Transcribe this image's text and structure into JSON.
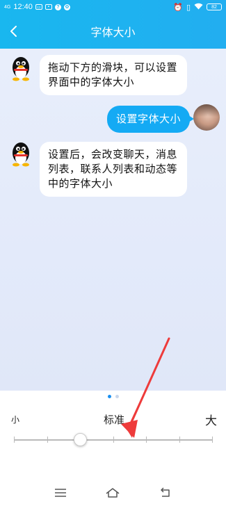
{
  "status_bar": {
    "network": "4G",
    "time": "12:40",
    "battery": "82"
  },
  "nav": {
    "title": "字体大小"
  },
  "messages": [
    {
      "sender": "qq",
      "text": "拖动下方的滑块，可以设置界面中的字体大小"
    },
    {
      "sender": "me",
      "text": "设置字体大小"
    },
    {
      "sender": "qq",
      "text": "设置后，会改变聊天，消息列表，联系人列表和动态等中的字体大小"
    }
  ],
  "pager": {
    "pages": 2,
    "current": 1
  },
  "font_size": {
    "small_label": "小",
    "standard_label": "标准",
    "large_label": "大",
    "steps": 7,
    "selected_step": 2
  },
  "colors": {
    "accent": "#14aaf4",
    "arrow": "#ee3b3b"
  },
  "icons": {
    "back": "chevron-left-icon",
    "menu": "menu-icon",
    "home": "home-icon",
    "return": "return-icon"
  }
}
